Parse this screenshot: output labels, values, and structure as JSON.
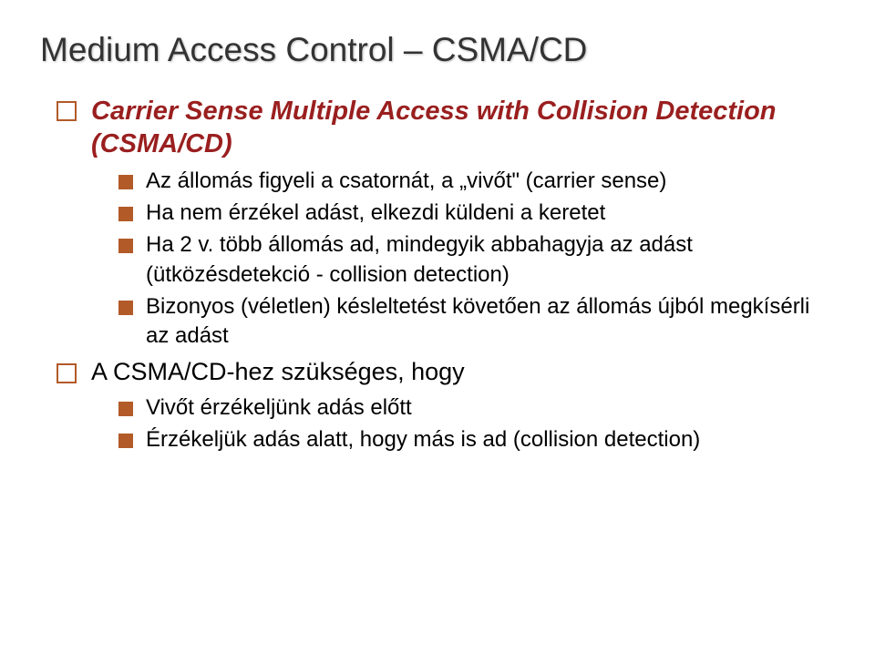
{
  "title": "Medium Access Control – CSMA/CD",
  "items": [
    {
      "type": "lvl1",
      "style": "emph",
      "text": "Carrier Sense Multiple Access with Collision Detection (CSMA/CD)",
      "children": [
        {
          "text": "Az állomás figyeli a csatornát, a „vivőt\" (carrier sense)"
        },
        {
          "text": "Ha nem érzékel adást, elkezdi küldeni a keretet"
        },
        {
          "text": "Ha 2 v. több állomás ad, mindegyik abbahagyja az adást (ütközésdetekció - collision detection)"
        },
        {
          "text": "Bizonyos (véletlen) késleltetést követően az állomás újból megkísérli az adást"
        }
      ]
    },
    {
      "type": "lvl1",
      "style": "plain",
      "text": "A CSMA/CD-hez szükséges, hogy",
      "children": [
        {
          "text": "Vivőt érzékeljünk adás előtt"
        },
        {
          "text": "Érzékeljük adás alatt, hogy más is ad (collision detection)"
        }
      ]
    }
  ]
}
